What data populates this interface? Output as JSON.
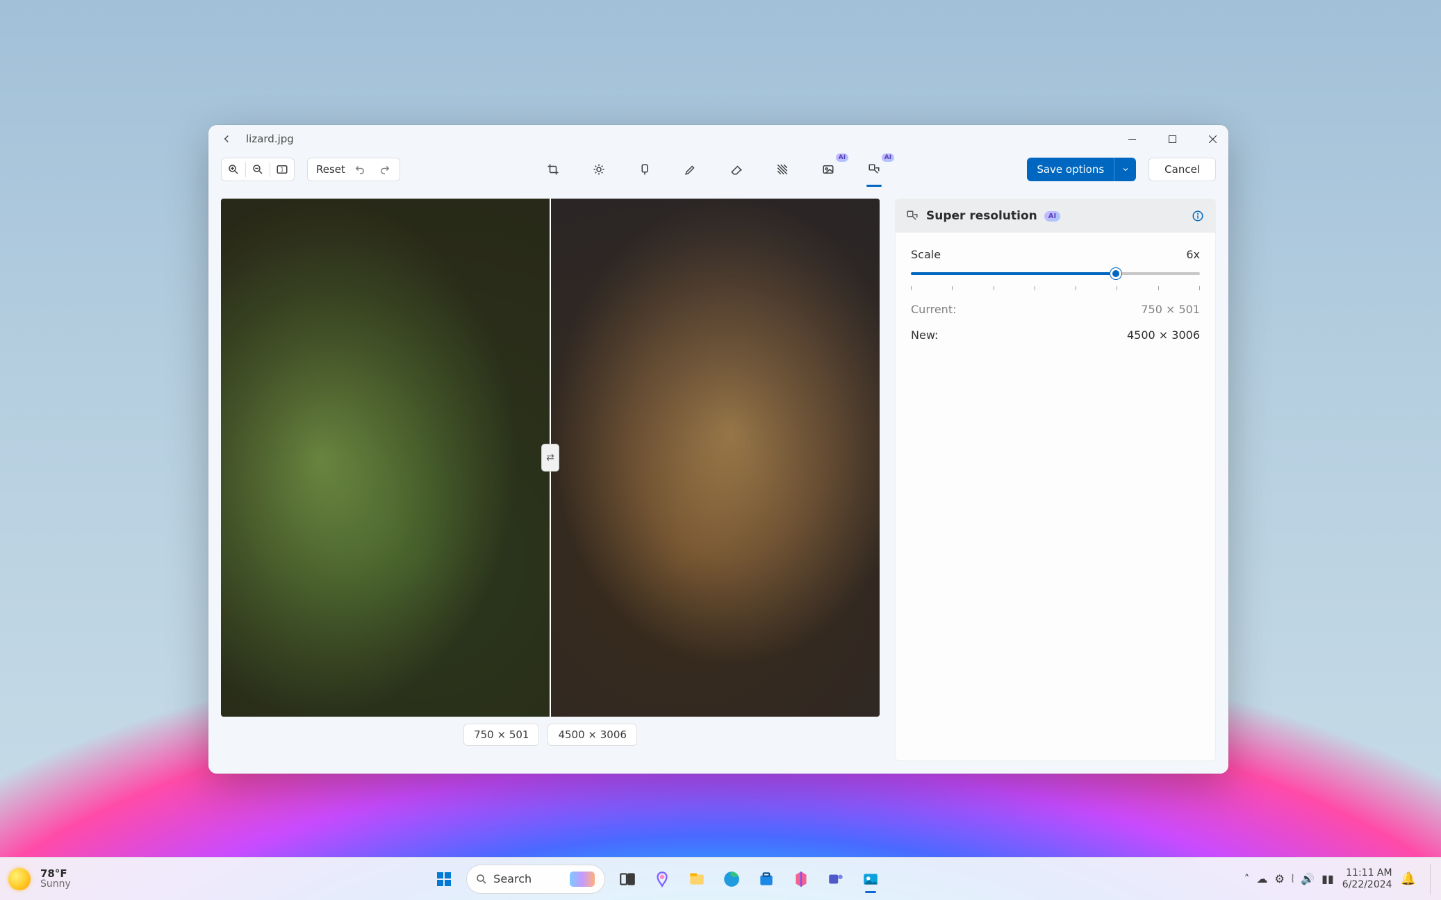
{
  "window": {
    "filename": "lizard.jpg",
    "toolbar": {
      "reset": "Reset",
      "save_label": "Save options",
      "cancel_label": "Cancel"
    },
    "panel": {
      "title": "Super resolution",
      "ai_badge": "AI",
      "scale_label": "Scale",
      "scale_value": "6x",
      "scale_fill_pct": 71,
      "scale_ticks": 8,
      "current_label": "Current:",
      "current_value": "750 × 501",
      "new_label": "New:",
      "new_value": "4500 × 3006"
    },
    "canvas": {
      "left_dim": "750 × 501",
      "right_dim": "4500 × 3006",
      "handle_glyph": "⇄"
    }
  },
  "taskbar": {
    "weather": {
      "temp": "78°F",
      "cond": "Sunny"
    },
    "search_label": "Search",
    "clock": {
      "time": "11:11 AM",
      "date": "6/22/2024"
    }
  }
}
